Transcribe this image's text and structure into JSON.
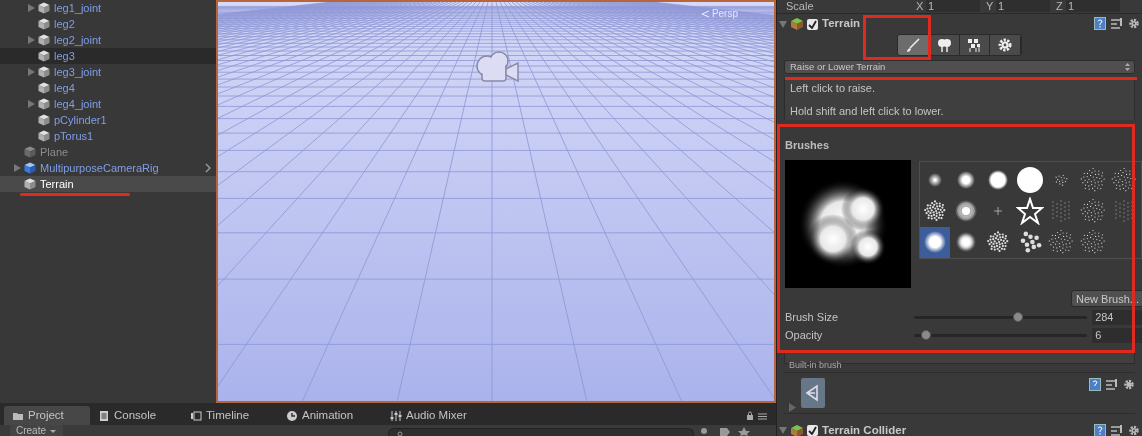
{
  "hierarchy": {
    "branch_items": [
      {
        "name": "leg1_joint",
        "kind": "prefab-child",
        "expandable": true,
        "selected": false,
        "highlighted": false
      },
      {
        "name": "leg2",
        "kind": "prefab-child",
        "expandable": false,
        "selected": false,
        "highlighted": false
      },
      {
        "name": "leg2_joint",
        "kind": "prefab-child",
        "expandable": true,
        "selected": false,
        "highlighted": false
      },
      {
        "name": "leg3",
        "kind": "prefab-child",
        "expandable": false,
        "selected": false,
        "highlighted": true
      },
      {
        "name": "leg3_joint",
        "kind": "prefab-child",
        "expandable": true,
        "selected": false,
        "highlighted": false
      },
      {
        "name": "leg4",
        "kind": "prefab-child",
        "expandable": false,
        "selected": false,
        "highlighted": false
      },
      {
        "name": "leg4_joint",
        "kind": "prefab-child",
        "expandable": true,
        "selected": false,
        "highlighted": false
      },
      {
        "name": "pCylinder1",
        "kind": "prefab-child",
        "expandable": false,
        "selected": false,
        "highlighted": false
      },
      {
        "name": "pTorus1",
        "kind": "prefab-child",
        "expandable": false,
        "selected": false,
        "highlighted": false
      }
    ],
    "items": [
      {
        "name": "Plane",
        "kind": "inactive",
        "expandable": false,
        "selected": false,
        "has_more": false
      },
      {
        "name": "MultipurposeCameraRig",
        "kind": "prefab-root",
        "expandable": true,
        "selected": false,
        "has_more": true
      },
      {
        "name": "Terrain",
        "kind": "object",
        "expandable": false,
        "selected": true,
        "has_more": false
      }
    ]
  },
  "scene": {
    "view_label": "Persp"
  },
  "inspector": {
    "transform_row": {
      "label": "Scale",
      "fields": [
        {
          "axis": "X",
          "value": "1"
        },
        {
          "axis": "Y",
          "value": "1"
        },
        {
          "axis": "Z",
          "value": "1"
        }
      ]
    },
    "terrain": {
      "title": "Terrain",
      "enabled": true,
      "tools": [
        {
          "kind": "paint",
          "selected": true
        },
        {
          "kind": "trees",
          "selected": false
        },
        {
          "kind": "details",
          "selected": false
        },
        {
          "kind": "settings",
          "selected": false
        }
      ],
      "tool_dropdown": "Raise or Lower Terrain",
      "help": [
        "Left click to raise.",
        "Hold shift and left click to lower."
      ],
      "brushes_title": "Brushes",
      "brushes": [
        {
          "kind": "soft-small",
          "selected": false
        },
        {
          "kind": "soft-medium",
          "selected": false
        },
        {
          "kind": "soft-large",
          "selected": false
        },
        {
          "kind": "hard-large",
          "selected": false
        },
        {
          "kind": "speckle-small",
          "selected": false
        },
        {
          "kind": "speckle",
          "selected": false
        },
        {
          "kind": "speckle",
          "selected": false
        },
        {
          "kind": "splat",
          "selected": false
        },
        {
          "kind": "spiral",
          "selected": false
        },
        {
          "kind": "spark",
          "selected": false
        },
        {
          "kind": "star",
          "selected": false
        },
        {
          "kind": "streaks",
          "selected": false
        },
        {
          "kind": "speckle",
          "selected": false
        },
        {
          "kind": "streaks",
          "selected": false
        },
        {
          "kind": "cloud",
          "selected": true
        },
        {
          "kind": "smudge",
          "selected": false
        },
        {
          "kind": "splat",
          "selected": false
        },
        {
          "kind": "dots",
          "selected": false
        },
        {
          "kind": "speckle",
          "selected": false
        },
        {
          "kind": "speckle",
          "selected": false
        }
      ],
      "new_brush_button": "New Brush...",
      "sliders": [
        {
          "label": "Brush Size",
          "level": 0.6,
          "value": "284"
        },
        {
          "label": "Opacity",
          "level": 0.07,
          "value": "6"
        }
      ],
      "brush_note": "Built-in brush"
    },
    "terrain_collider": {
      "title": "Terrain Collider",
      "enabled": true
    }
  },
  "bottom_tabs": [
    {
      "kind": "project",
      "label": "Project",
      "selected": true
    },
    {
      "kind": "console",
      "label": "Console",
      "selected": false
    },
    {
      "kind": "timeline",
      "label": "Timeline",
      "selected": false
    },
    {
      "kind": "animation",
      "label": "Animation",
      "selected": false
    },
    {
      "kind": "mixer",
      "label": "Audio Mixer",
      "selected": false
    }
  ],
  "project_toolbar": {
    "create_button": "Create"
  }
}
